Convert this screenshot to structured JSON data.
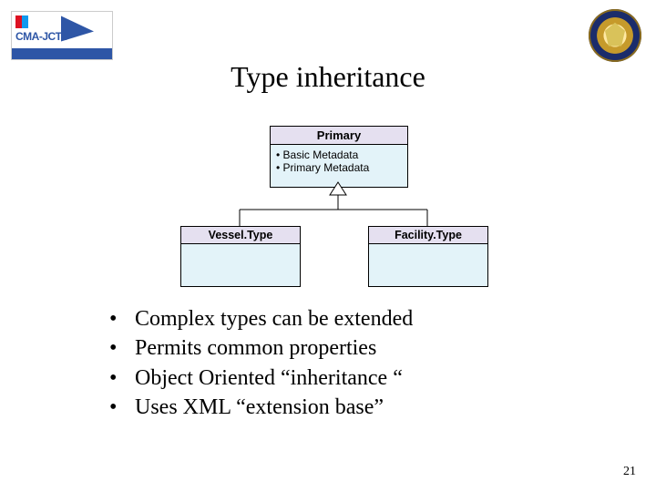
{
  "title": "Type inheritance",
  "logo_left": {
    "brand": "CMA-JCTD"
  },
  "diagram": {
    "parent": {
      "name": "Primary",
      "props": [
        "Basic Metadata",
        "Primary Metadata"
      ]
    },
    "children": [
      {
        "name": "Vessel.Type"
      },
      {
        "name": "Facility.Type"
      }
    ]
  },
  "bullets": [
    "Complex types can be extended",
    "Permits common properties",
    "Object Oriented “inheritance “",
    "Uses XML “extension base”"
  ],
  "page_number": "21"
}
